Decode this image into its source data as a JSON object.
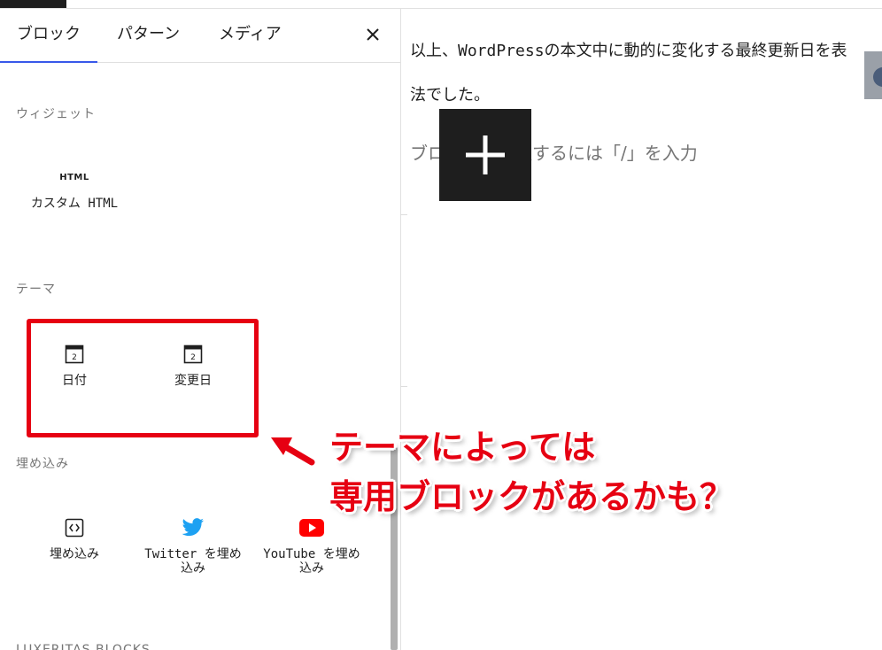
{
  "tabs": [
    {
      "label": "ブロック",
      "active": true
    },
    {
      "label": "パターン",
      "active": false
    },
    {
      "label": "メディア",
      "active": false
    }
  ],
  "close_icon": "close-icon",
  "sections": {
    "widgets": {
      "title": "ウィジェット",
      "items": [
        {
          "label": "カスタム HTML",
          "icon": "HTML"
        }
      ]
    },
    "theme": {
      "title": "テーマ",
      "items": [
        {
          "label": "日付",
          "icon": "calendar-icon",
          "day": "2"
        },
        {
          "label": "変更日",
          "icon": "calendar-icon",
          "day": "2"
        }
      ]
    },
    "embed": {
      "title": "埋め込み",
      "items": [
        {
          "label": "埋め込み",
          "icon": "embed-icon"
        },
        {
          "label": "Twitter を埋め込み",
          "icon": "twitter-icon"
        },
        {
          "label": "YouTube を埋め込み",
          "icon": "youtube-icon"
        }
      ]
    },
    "next_title": "LUXERITAS BLOCKS"
  },
  "annotation": {
    "line1": "テーマによっては",
    "line2": "専用ブロックがあるかも？",
    "color": "#e60012"
  },
  "editor": {
    "paragraph_line1": "以上、WordPressの本文中に動的に変化する最終更新日を表",
    "paragraph_line2": "法でした。",
    "placeholder_start": "ブロ",
    "placeholder_end": "択するには「/」を入力"
  },
  "colors": {
    "accent": "#3858e9",
    "twitter": "#1da1f2",
    "youtube": "#ff0000",
    "dark": "#1e1e1e"
  }
}
